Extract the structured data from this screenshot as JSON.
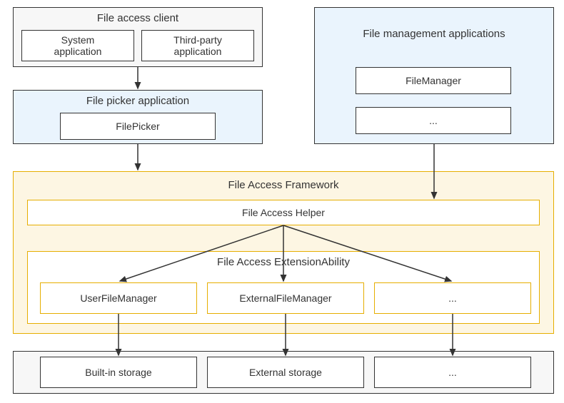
{
  "top_left": {
    "title": "File access client",
    "system": "System\napplication",
    "third_party": "Third-party\napplication"
  },
  "top_right": {
    "title": "File management applications",
    "item1": "FileManager",
    "item2": "..."
  },
  "picker": {
    "title": "File picker application",
    "item": "FilePicker"
  },
  "framework": {
    "title": "File Access Framework",
    "helper": "File Access Helper",
    "ext_title": "File Access ExtensionAbility",
    "user_mgr": "UserFileManager",
    "ext_mgr": "ExternalFileManager",
    "more": "..."
  },
  "storage": {
    "builtin": "Built-in storage",
    "external": "External storage",
    "more": "..."
  }
}
